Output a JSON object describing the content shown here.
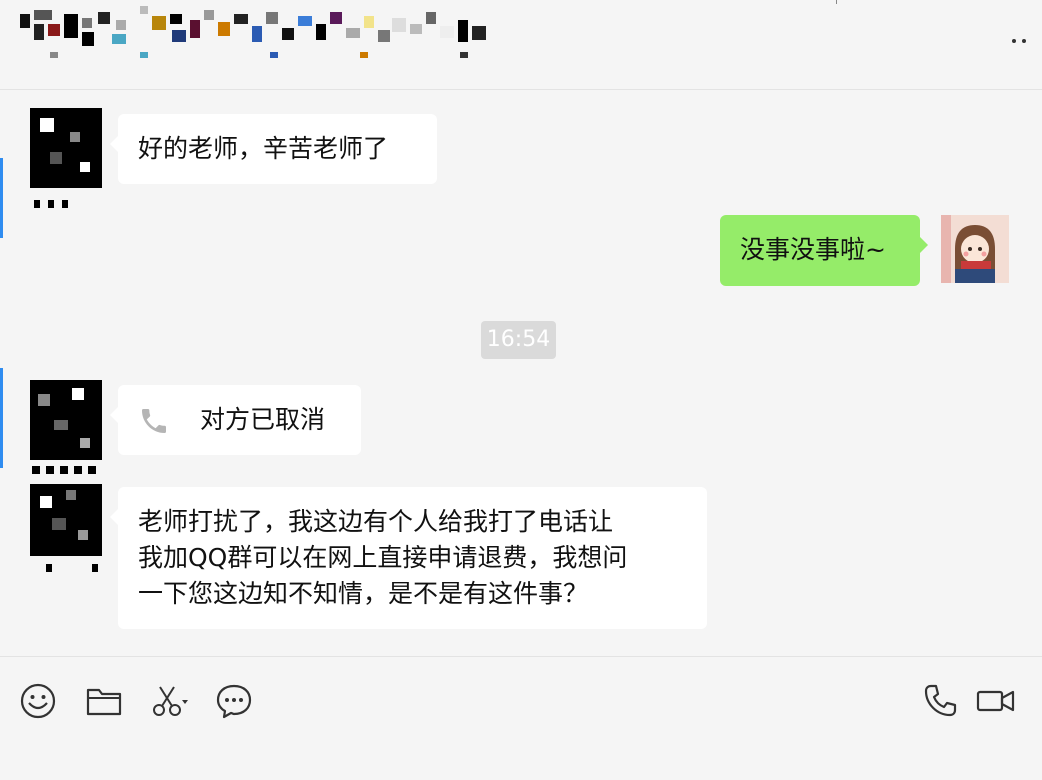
{
  "colors": {
    "background": "#f5f5f5",
    "bubble_incoming": "#ffffff",
    "bubble_outgoing": "#95ec69",
    "timestamp_bg": "#dadada",
    "edge_marker": "#2f8cf0"
  },
  "header": {
    "more_icon": "more-dots-icon"
  },
  "messages": [
    {
      "sender": "other",
      "text": "好的老师，辛苦老师了"
    },
    {
      "sender": "self",
      "text": "没事没事啦~"
    },
    {
      "type": "timestamp",
      "text": "16:54"
    },
    {
      "sender": "other",
      "type": "call",
      "icon": "phone-icon",
      "text": "对方已取消"
    },
    {
      "sender": "other",
      "lines": [
        "老师打扰了，我这边有个人给我打了电话让",
        "我加QQ群可以在网上直接申请退费，我想问",
        "一下您这边知不知情，是不是有这件事？"
      ]
    }
  ],
  "toolbar": {
    "left_icons": [
      "emoji-icon",
      "folder-icon",
      "scissors-icon",
      "chat-bubble-icon"
    ],
    "right_icons": [
      "phone-icon",
      "video-call-icon"
    ]
  }
}
